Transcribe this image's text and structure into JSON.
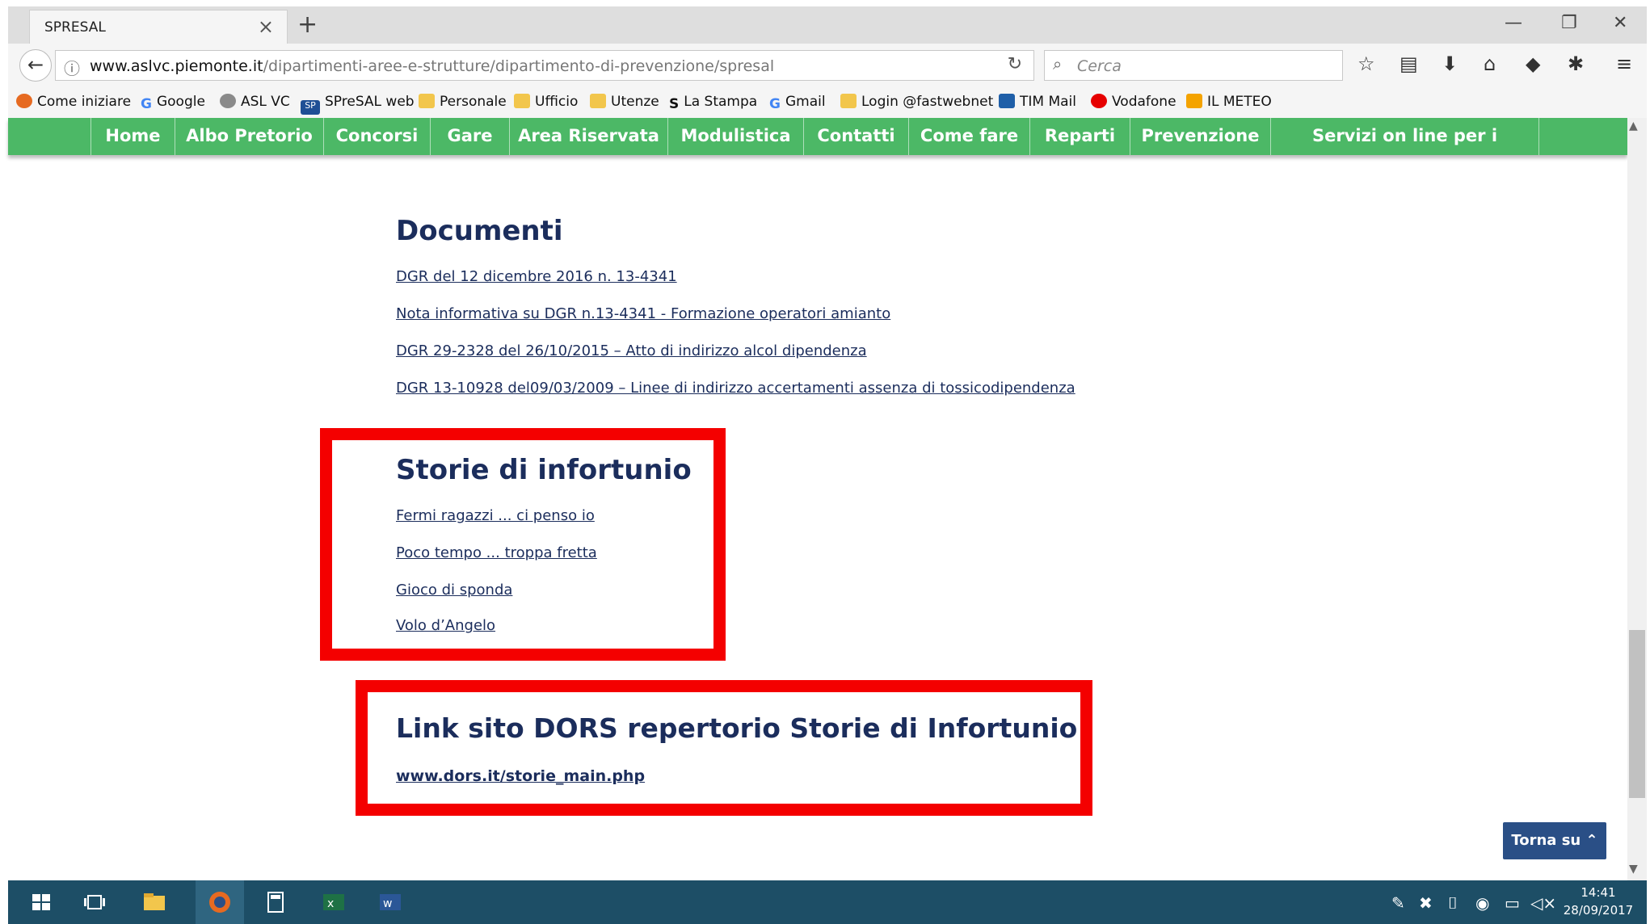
{
  "browser": {
    "tab_title": "SPRESAL",
    "url_domain": "www.aslvc.piemonte.it",
    "url_path": "/dipartimenti-aree-e-strutture/dipartimento-di-prevenzione/spresal",
    "search_placeholder": "Cerca"
  },
  "bookmarks": [
    {
      "label": "Come iniziare"
    },
    {
      "label": "Google"
    },
    {
      "label": "ASL VC"
    },
    {
      "label": "SPreSAL web"
    },
    {
      "label": "Personale"
    },
    {
      "label": "Ufficio"
    },
    {
      "label": "Utenze"
    },
    {
      "label": "La Stampa"
    },
    {
      "label": "Gmail"
    },
    {
      "label": "Login @fastwebnet"
    },
    {
      "label": "TIM Mail"
    },
    {
      "label": "Vodafone"
    },
    {
      "label": "IL METEO"
    }
  ],
  "menu": [
    "Home",
    "Albo Pretorio",
    "Concorsi",
    "Gare",
    "Area Riservata",
    "Modulistica",
    "Contatti",
    "Come fare",
    "Reparti",
    "Prevenzione",
    "Servizi on line per i cittadini"
  ],
  "documenti": {
    "title": "Documenti",
    "links": [
      "DGR del 12 dicembre 2016 n. 13-4341",
      "Nota informativa su DGR n.13-4341 - Formazione operatori amianto",
      "DGR 29-2328 del 26/10/2015 – Atto di indirizzo alcol dipendenza",
      "DGR 13-10928 del09/03/2009 – Linee di indirizzo accertamenti assenza di tossicodipendenza"
    ]
  },
  "storie": {
    "title": "Storie di infortunio",
    "links": [
      "Fermi ragazzi ... ci penso io",
      "Poco tempo ... troppa fretta",
      "Gioco di sponda",
      "Volo d’Angelo"
    ]
  },
  "dors": {
    "title": "Link sito DORS repertorio Storie di Infortunio",
    "link": "www.dors.it/storie_main.php"
  },
  "torna_su": "Torna su",
  "taskbar": {
    "time": "14:41",
    "date": "28/09/2017"
  },
  "colors": {
    "menu_green": "#4cb866",
    "heading_navy": "#1b2d5c",
    "highlight_red": "#f40000",
    "torna_su_blue": "#2a4f86",
    "taskbar": "#1d4e66"
  }
}
